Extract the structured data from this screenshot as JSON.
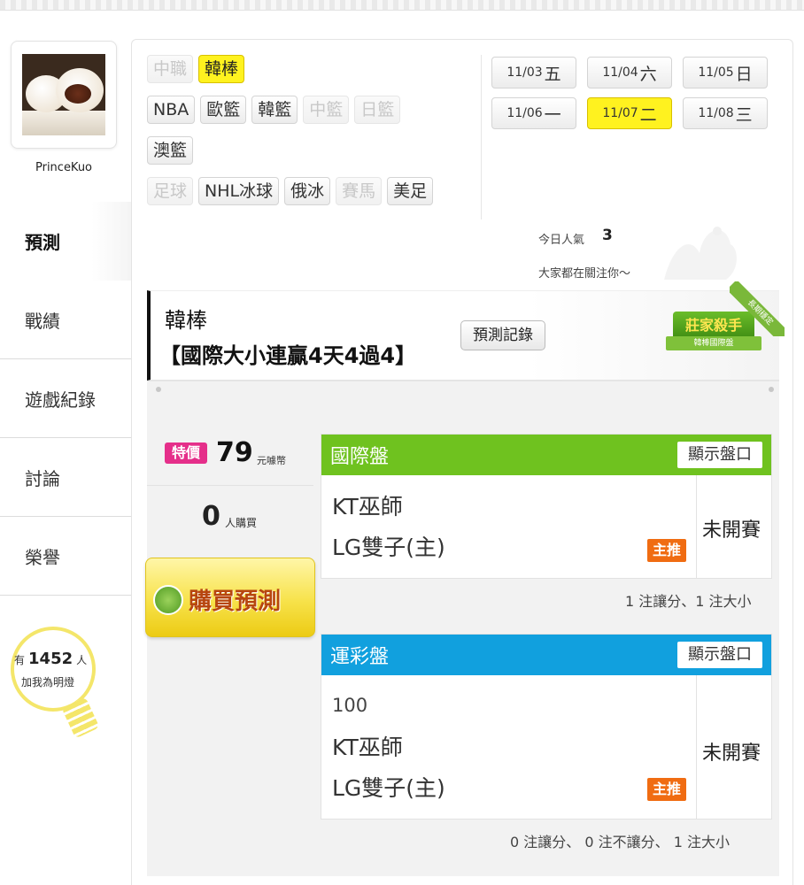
{
  "user": {
    "name": "PrinceKuo"
  },
  "nav": [
    {
      "label": "預測",
      "active": true
    },
    {
      "label": "戰績"
    },
    {
      "label": "遊戲紀錄"
    },
    {
      "label": "討論"
    },
    {
      "label": "榮譽"
    }
  ],
  "fans": {
    "prefix": "有",
    "count": "1452",
    "suffix": "人",
    "label": "加我為明燈"
  },
  "categories": {
    "row1": [
      {
        "label": "中職",
        "state": "dim"
      },
      {
        "label": "韓棒",
        "state": "sel"
      }
    ],
    "row2": [
      {
        "label": "NBA"
      },
      {
        "label": "歐籃"
      },
      {
        "label": "韓籃"
      },
      {
        "label": "中籃",
        "state": "dim"
      },
      {
        "label": "日籃",
        "state": "dim"
      }
    ],
    "row3": [
      {
        "label": "澳籃"
      }
    ],
    "row4": [
      {
        "label": "足球",
        "state": "dim"
      },
      {
        "label": "NHL冰球"
      },
      {
        "label": "俄冰"
      },
      {
        "label": "賽馬",
        "state": "dim"
      },
      {
        "label": "美足"
      }
    ]
  },
  "dates": [
    {
      "md": "11/03",
      "day": "五"
    },
    {
      "md": "11/04",
      "day": "六"
    },
    {
      "md": "11/05",
      "day": "日"
    },
    {
      "md": "11/06",
      "day": "一"
    },
    {
      "md": "11/07",
      "day": "二",
      "selected": true
    },
    {
      "md": "11/08",
      "day": "三"
    }
  ],
  "popularity": {
    "label": "今日人氣",
    "value": "3",
    "note": "大家都在關注你～"
  },
  "title": {
    "line1": "韓棒",
    "line2": "【國際大小連贏4天4過4】",
    "record_button": "預測記錄"
  },
  "badge": {
    "main": "莊家殺手",
    "sub": "韓棒國際盤",
    "ribbon": "長期穩定"
  },
  "price": {
    "tag": "特價",
    "value": "79",
    "unit": "元噱幣",
    "buyers": "0",
    "buyers_unit": "人購買",
    "buy_button": "購買預測"
  },
  "international": {
    "title": "國際盤",
    "show_button": "顯示盤口",
    "away": "KT巫師",
    "home": "LG雙子(主)",
    "rec": "主推",
    "status": "未開賽",
    "summary": "1 注讓分、1 注大小"
  },
  "lottery": {
    "title": "運彩盤",
    "show_button": "顯示盤口",
    "line": "100",
    "away": "KT巫師",
    "home": "LG雙子(主)",
    "rec": "主推",
    "status": "未開賽",
    "summary": "0 注讓分、 0 注不讓分、 1 注大小"
  }
}
